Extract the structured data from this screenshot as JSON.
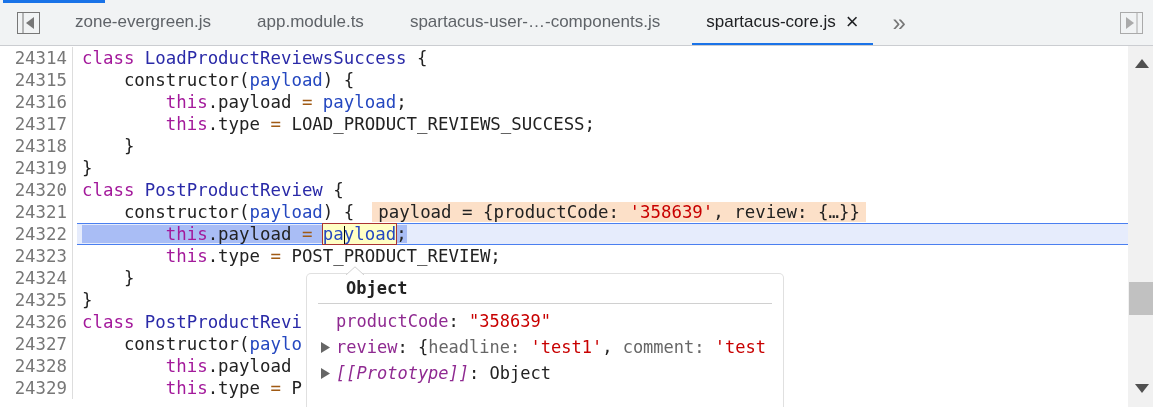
{
  "tabbar": {
    "tabs": [
      {
        "label": "zone-evergreen.js",
        "selected": false
      },
      {
        "label": "app.module.ts",
        "selected": false
      },
      {
        "label": "spartacus-user-…-components.js",
        "selected": false
      },
      {
        "label": "spartacus-core.js",
        "selected": true,
        "close_button": "×"
      }
    ],
    "overflow_button": "»"
  },
  "editor": {
    "lines": [
      {
        "number": "24314",
        "current": false,
        "tokens": [
          {
            "kind": "keyword",
            "text": "class"
          },
          {
            "kind": "def",
            "text": " LoadProductReviewsSuccess"
          },
          {
            "kind": "plain",
            "text": " {"
          }
        ]
      },
      {
        "number": "24315",
        "current": false,
        "tokens": [
          {
            "kind": "plain",
            "text": "    constructor("
          },
          {
            "kind": "param",
            "text": "payload"
          },
          {
            "kind": "plain",
            "text": ") {"
          }
        ]
      },
      {
        "number": "24316",
        "current": false,
        "tokens": [
          {
            "kind": "keyword",
            "text": "        this"
          },
          {
            "kind": "plain",
            "text": ".payload "
          },
          {
            "kind": "operator",
            "text": "="
          },
          {
            "kind": "param",
            "text": " payload"
          },
          {
            "kind": "plain",
            "text": ";"
          }
        ]
      },
      {
        "number": "24317",
        "current": false,
        "tokens": [
          {
            "kind": "keyword",
            "text": "        this"
          },
          {
            "kind": "plain",
            "text": ".type "
          },
          {
            "kind": "operator",
            "text": "="
          },
          {
            "kind": "plain",
            "text": " LOAD_PRODUCT_REVIEWS_SUCCESS;"
          }
        ]
      },
      {
        "number": "24318",
        "current": false,
        "tokens": [
          {
            "kind": "plain",
            "text": "    }"
          }
        ]
      },
      {
        "number": "24319",
        "current": false,
        "tokens": [
          {
            "kind": "plain",
            "text": "}"
          }
        ]
      },
      {
        "number": "24320",
        "current": false,
        "tokens": [
          {
            "kind": "keyword",
            "text": "class"
          },
          {
            "kind": "def",
            "text": " PostProductReview"
          },
          {
            "kind": "plain",
            "text": " {"
          }
        ]
      },
      {
        "number": "24321",
        "current": false,
        "tokens": [
          {
            "kind": "plain",
            "text": "    constructor("
          },
          {
            "kind": "param",
            "text": "payload"
          },
          {
            "kind": "plain",
            "text": ") {"
          }
        ],
        "inline_value": [
          {
            "kind": "plain",
            "text": "payload = {productCode: "
          },
          {
            "kind": "string",
            "text": "'358639'"
          },
          {
            "kind": "plain",
            "text": ", review: {…}}"
          }
        ]
      },
      {
        "number": "24322",
        "current": true,
        "tokens": [
          {
            "kind": "keyword",
            "text": "        this"
          },
          {
            "kind": "plain",
            "text": ".payload "
          },
          {
            "kind": "operator",
            "text": "= "
          },
          {
            "kind": "hovered",
            "text": "payload"
          },
          {
            "kind": "plain",
            "text": ";"
          }
        ]
      },
      {
        "number": "24323",
        "current": false,
        "tokens": [
          {
            "kind": "keyword",
            "text": "        this"
          },
          {
            "kind": "plain",
            "text": ".type "
          },
          {
            "kind": "operator",
            "text": "="
          },
          {
            "kind": "plain",
            "text": " POST_PRODUCT_REVIEW;"
          }
        ]
      },
      {
        "number": "24324",
        "current": false,
        "tokens": [
          {
            "kind": "plain",
            "text": "    }"
          }
        ]
      },
      {
        "number": "24325",
        "current": false,
        "tokens": [
          {
            "kind": "plain",
            "text": "}"
          }
        ]
      },
      {
        "number": "24326",
        "current": false,
        "tokens": [
          {
            "kind": "keyword",
            "text": "class"
          },
          {
            "kind": "def",
            "text": " PostProductRevi"
          }
        ]
      },
      {
        "number": "24327",
        "current": false,
        "tokens": [
          {
            "kind": "plain",
            "text": "    constructor("
          },
          {
            "kind": "param",
            "text": "paylo"
          }
        ]
      },
      {
        "number": "24328",
        "current": false,
        "tokens": [
          {
            "kind": "keyword",
            "text": "        this"
          },
          {
            "kind": "plain",
            "text": ".payload"
          }
        ]
      },
      {
        "number": "24329",
        "current": false,
        "tokens": [
          {
            "kind": "keyword",
            "text": "        this"
          },
          {
            "kind": "plain",
            "text": ".type "
          },
          {
            "kind": "operator",
            "text": "="
          },
          {
            "kind": "plain",
            "text": " P"
          }
        ]
      }
    ]
  },
  "popover": {
    "title": "Object",
    "properties": [
      {
        "expandable": false,
        "parts": [
          {
            "kind": "key",
            "text": "productCode"
          },
          {
            "kind": "plain",
            "text": ": "
          },
          {
            "kind": "string",
            "text": "\"358639\""
          }
        ]
      },
      {
        "expandable": true,
        "parts": [
          {
            "kind": "key",
            "text": "review"
          },
          {
            "kind": "plain",
            "text": ": {"
          },
          {
            "kind": "muted",
            "text": "headline: "
          },
          {
            "kind": "string",
            "text": "'test1'"
          },
          {
            "kind": "plain",
            "text": ", "
          },
          {
            "kind": "muted",
            "text": "comment: "
          },
          {
            "kind": "string",
            "text": "'test"
          }
        ]
      },
      {
        "expandable": true,
        "parts": [
          {
            "kind": "internal",
            "text": "[[Prototype]]"
          },
          {
            "kind": "plain",
            "text": ": Object"
          }
        ]
      }
    ]
  }
}
